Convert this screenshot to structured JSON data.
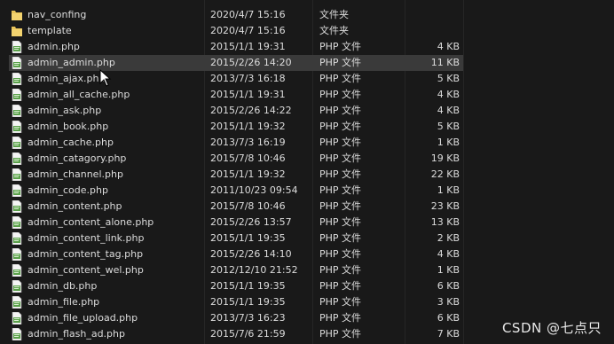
{
  "files": [
    {
      "name": "nav_confing",
      "date": "2020/4/7 15:16",
      "type": "文件夹",
      "size": "",
      "kind": "folder-icon",
      "selected": false
    },
    {
      "name": "template",
      "date": "2020/4/7 15:16",
      "type": "文件夹",
      "size": "",
      "kind": "folder-icon",
      "selected": false
    },
    {
      "name": "admin.php",
      "date": "2015/1/1 19:31",
      "type": "PHP 文件",
      "size": "4 KB",
      "kind": "php-file-icon",
      "selected": false
    },
    {
      "name": "admin_admin.php",
      "date": "2015/2/26 14:20",
      "type": "PHP 文件",
      "size": "11 KB",
      "kind": "php-file-icon",
      "selected": true
    },
    {
      "name": "admin_ajax.php",
      "date": "2013/7/3 16:18",
      "type": "PHP 文件",
      "size": "5 KB",
      "kind": "php-file-icon",
      "selected": false
    },
    {
      "name": "admin_all_cache.php",
      "date": "2015/1/1 19:31",
      "type": "PHP 文件",
      "size": "4 KB",
      "kind": "php-file-icon",
      "selected": false
    },
    {
      "name": "admin_ask.php",
      "date": "2015/2/26 14:22",
      "type": "PHP 文件",
      "size": "4 KB",
      "kind": "php-file-icon",
      "selected": false
    },
    {
      "name": "admin_book.php",
      "date": "2015/1/1 19:32",
      "type": "PHP 文件",
      "size": "5 KB",
      "kind": "php-file-icon",
      "selected": false
    },
    {
      "name": "admin_cache.php",
      "date": "2013/7/3 16:19",
      "type": "PHP 文件",
      "size": "1 KB",
      "kind": "php-file-icon",
      "selected": false
    },
    {
      "name": "admin_catagory.php",
      "date": "2015/7/8 10:46",
      "type": "PHP 文件",
      "size": "19 KB",
      "kind": "php-file-icon",
      "selected": false
    },
    {
      "name": "admin_channel.php",
      "date": "2015/1/1 19:32",
      "type": "PHP 文件",
      "size": "22 KB",
      "kind": "php-file-icon",
      "selected": false
    },
    {
      "name": "admin_code.php",
      "date": "2011/10/23 09:54",
      "type": "PHP 文件",
      "size": "1 KB",
      "kind": "php-file-icon",
      "selected": false
    },
    {
      "name": "admin_content.php",
      "date": "2015/7/8 10:46",
      "type": "PHP 文件",
      "size": "23 KB",
      "kind": "php-file-icon",
      "selected": false
    },
    {
      "name": "admin_content_alone.php",
      "date": "2015/2/26 13:57",
      "type": "PHP 文件",
      "size": "13 KB",
      "kind": "php-file-icon",
      "selected": false
    },
    {
      "name": "admin_content_link.php",
      "date": "2015/1/1 19:35",
      "type": "PHP 文件",
      "size": "2 KB",
      "kind": "php-file-icon",
      "selected": false
    },
    {
      "name": "admin_content_tag.php",
      "date": "2015/2/26 14:10",
      "type": "PHP 文件",
      "size": "4 KB",
      "kind": "php-file-icon",
      "selected": false
    },
    {
      "name": "admin_content_wel.php",
      "date": "2012/12/10 21:52",
      "type": "PHP 文件",
      "size": "1 KB",
      "kind": "php-file-icon",
      "selected": false
    },
    {
      "name": "admin_db.php",
      "date": "2015/1/1 19:35",
      "type": "PHP 文件",
      "size": "6 KB",
      "kind": "php-file-icon",
      "selected": false
    },
    {
      "name": "admin_file.php",
      "date": "2015/1/1 19:35",
      "type": "PHP 文件",
      "size": "3 KB",
      "kind": "php-file-icon",
      "selected": false
    },
    {
      "name": "admin_file_upload.php",
      "date": "2013/7/3 16:23",
      "type": "PHP 文件",
      "size": "6 KB",
      "kind": "php-file-icon",
      "selected": false
    },
    {
      "name": "admin_flash_ad.php",
      "date": "2015/7/6 21:59",
      "type": "PHP 文件",
      "size": "7 KB",
      "kind": "php-file-icon",
      "selected": false
    }
  ],
  "watermark": "CSDN @七点只",
  "colors": {
    "background": "#191919",
    "selected_row": "#3a3a3a",
    "folder": "#e8c35a",
    "text": "#dcdcdc"
  }
}
